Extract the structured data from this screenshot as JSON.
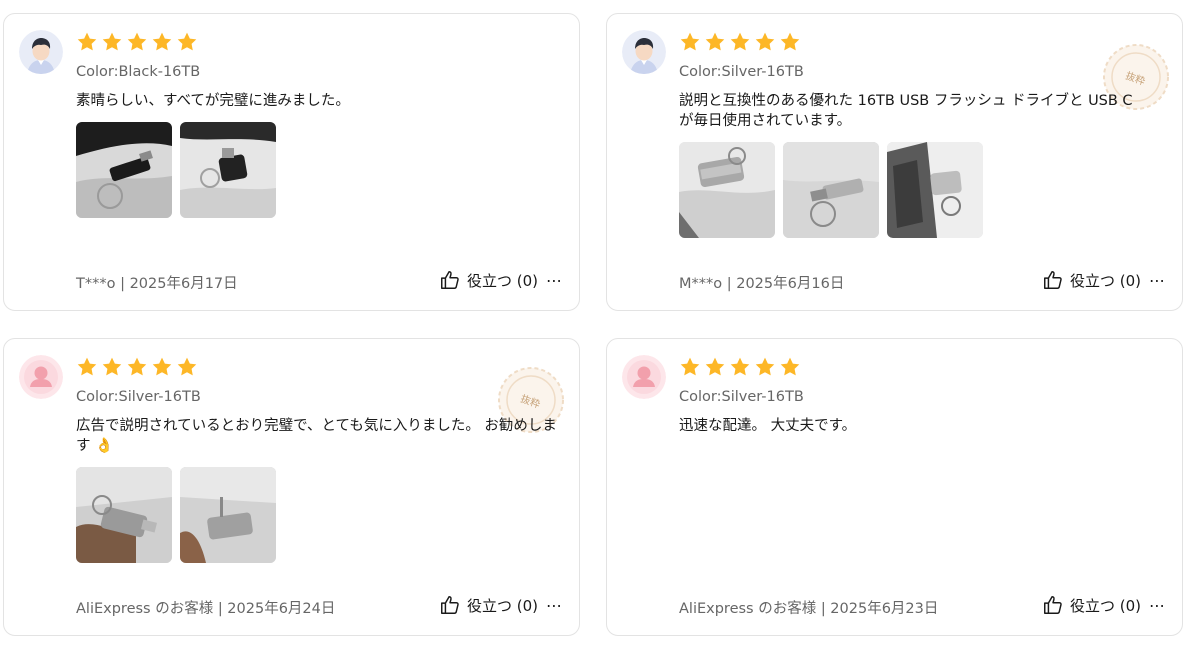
{
  "reviews": [
    {
      "avatar": "male-avatar",
      "rating": 5,
      "sku": "Color:Black-16TB",
      "text": "素晴らしい、すべてが完璧に進みました。",
      "images": [
        "black-usb-photo-1",
        "black-usb-photo-2"
      ],
      "meta": "T***o | 2025年6月17日",
      "helpful_label": "役立つ (0)",
      "selected_badge": ""
    },
    {
      "avatar": "male-avatar",
      "rating": 5,
      "sku": "Color:Silver-16TB",
      "text": "説明と互換性のある優れた 16TB USB フラッシュ ドライブと USB C が毎日使用されています。",
      "images": [
        "silver-usb-photo-1",
        "silver-usb-photo-2",
        "silver-usb-photo-3"
      ],
      "meta": "M***o | 2025年6月16日",
      "helpful_label": "役立つ (0)",
      "selected_badge": "抜粋"
    },
    {
      "avatar": "default-avatar",
      "rating": 5,
      "sku": "Color:Silver-16TB",
      "text": "広告で説明されているとおり完璧で、とても気に入りました。 お勧めします 👌",
      "images": [
        "silver-usb-photo-4",
        "silver-usb-photo-5"
      ],
      "meta": "AliExpress のお客様 | 2025年6月24日",
      "helpful_label": "役立つ (0)",
      "selected_badge": "抜粋"
    },
    {
      "avatar": "default-avatar",
      "rating": 5,
      "sku": "Color:Silver-16TB",
      "text": "迅速な配達。 大丈夫です。",
      "images": [],
      "meta": "AliExpress のお客様 | 2025年6月23日",
      "helpful_label": "役立つ (0)",
      "selected_badge": ""
    }
  ],
  "colors": {
    "star": "#fdb727",
    "card_border": "#e3e3e3",
    "secondary_text": "#666666",
    "seal": "#e8d2b8"
  }
}
